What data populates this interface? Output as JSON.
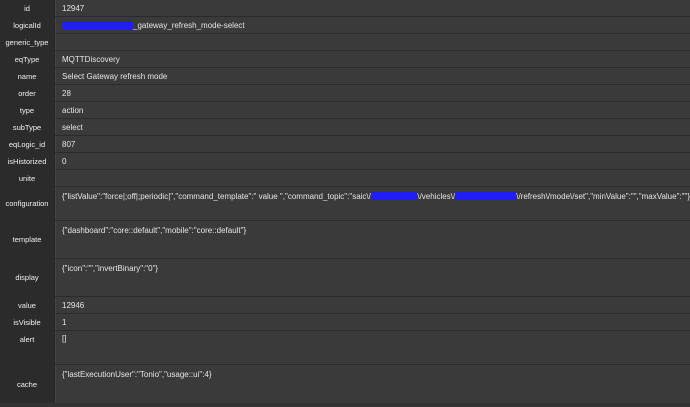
{
  "rows": {
    "id": {
      "label": "id",
      "value": "12947"
    },
    "logicalId": {
      "label": "logicalId",
      "value": "_gateway_refresh_mode-select"
    },
    "generic_type": {
      "label": "generic_type",
      "value": ""
    },
    "eqType": {
      "label": "eqType",
      "value": "MQTTDiscovery"
    },
    "name": {
      "label": "name",
      "value": "Select Gateway refresh mode"
    },
    "order": {
      "label": "order",
      "value": "28"
    },
    "type": {
      "label": "type",
      "value": "action"
    },
    "subType": {
      "label": "subType",
      "value": "select"
    },
    "eqLogic_id": {
      "label": "eqLogic_id",
      "value": "807"
    },
    "isHistorized": {
      "label": "isHistorized",
      "value": "0"
    },
    "unite": {
      "label": "unite",
      "value": ""
    },
    "configuration": {
      "label": "configuration",
      "value_part1": "{\"listValue\":\"force|;off|;periodic|\",\"command_template\":\" value \",\"command_topic\":\"saic\\/",
      "value_part2": "\\/vehicles\\/",
      "value_part3": "\\/refresh\\/mode\\/set\",\"minValue\":\"\",\"maxValue\":\"\"}"
    },
    "template": {
      "label": "template",
      "value": "{\"dashboard\":\"core::default\",\"mobile\":\"core::default\"}"
    },
    "display": {
      "label": "display",
      "value": "{\"icon\":\"\",\"invertBinary\":\"0\"}"
    },
    "value": {
      "label": "value",
      "value": "12946"
    },
    "isVisible": {
      "label": "isVisible",
      "value": "1"
    },
    "alert": {
      "label": "alert",
      "value": "[]"
    },
    "cache": {
      "label": "cache",
      "value": "{\"lastExecutionUser\":\"Tonio\",\"usage::ui\":4}"
    }
  },
  "colors": {
    "redaction": "#1f1ff5",
    "label_bg": "#2b2b2b",
    "value_bg": "#3a3a3a"
  }
}
